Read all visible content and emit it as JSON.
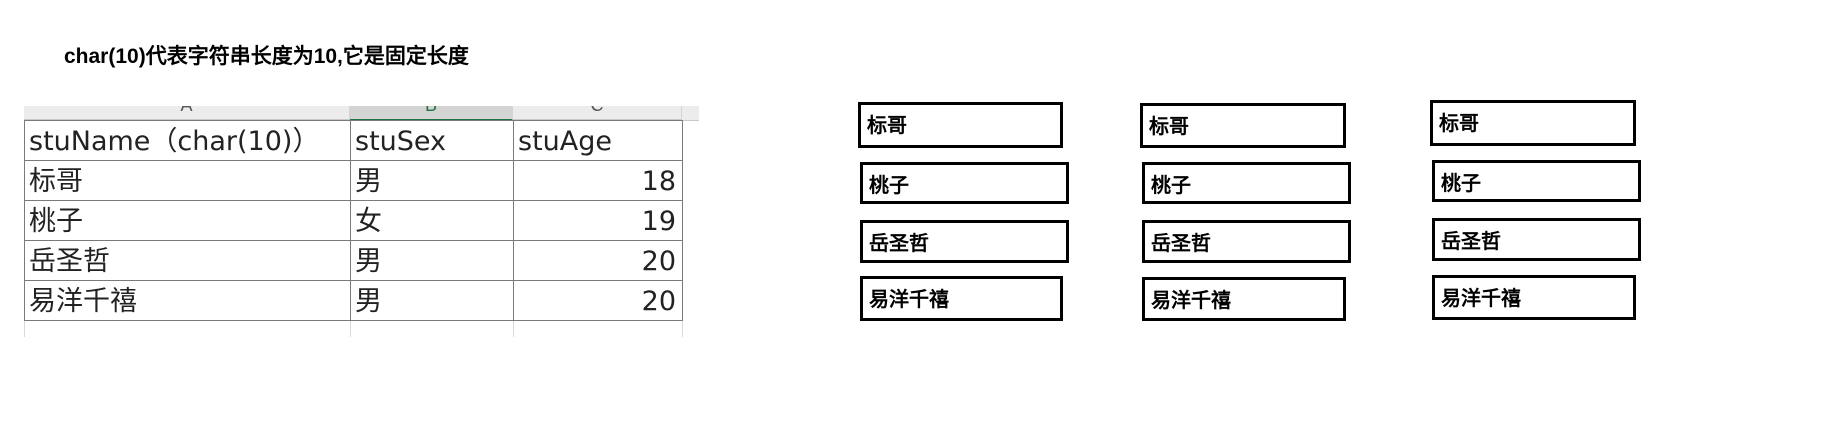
{
  "title": "char(10)代表字符串长度为10,它是固定长度",
  "sheet": {
    "column_letters": [
      "A",
      "B",
      "C"
    ],
    "headers": [
      "stuName（char(10)）",
      "stuSex",
      "stuAge"
    ],
    "rows": [
      [
        "标哥",
        "男",
        "18"
      ],
      [
        "桃子",
        "女",
        "19"
      ],
      [
        "岳圣哲",
        "男",
        "20"
      ],
      [
        "易洋千禧",
        "男",
        "20"
      ]
    ]
  },
  "box_groups": [
    [
      "标哥",
      "桃子",
      "岳圣哲",
      "易洋千禧"
    ],
    [
      "标哥",
      "桃子",
      "岳圣哲",
      "易洋千禧"
    ],
    [
      "标哥",
      "桃子",
      "岳圣哲",
      "易洋千禧"
    ]
  ]
}
